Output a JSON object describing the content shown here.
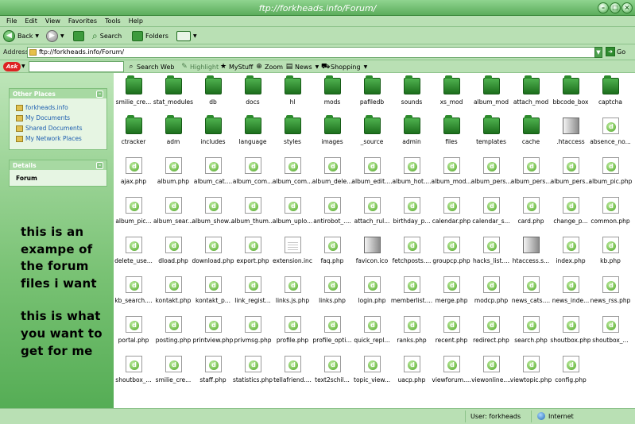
{
  "window": {
    "title": "ftp://forkheads.info/Forum/"
  },
  "menu": [
    "File",
    "Edit",
    "View",
    "Favorites",
    "Tools",
    "Help"
  ],
  "toolbar": {
    "back": "Back",
    "search": "Search",
    "folders": "Folders"
  },
  "address": {
    "label": "Address",
    "value": "ftp://forkheads.info/Forum/",
    "go": "Go"
  },
  "askbar": {
    "logo": "Ask",
    "search_web": "Search Web",
    "highlight": "Highlight",
    "mystuff": "MyStuff",
    "zoom": "Zoom",
    "news": "News",
    "shopping": "Shopping"
  },
  "sidebar": {
    "other_places": {
      "title": "Other Places",
      "items": [
        "forkheads.info",
        "My Documents",
        "Shared Documents",
        "My Network Places"
      ]
    },
    "details": {
      "title": "Details",
      "name": "Forum"
    }
  },
  "annotation": {
    "lines1": [
      "this is an",
      "exampe of",
      "the forum",
      "files i want"
    ],
    "lines2": [
      "this is what",
      "you want to",
      "get for me"
    ]
  },
  "files": [
    {
      "name": "smilie_cre...",
      "type": "folder"
    },
    {
      "name": "stat_modules",
      "type": "folder"
    },
    {
      "name": "db",
      "type": "folder"
    },
    {
      "name": "docs",
      "type": "folder"
    },
    {
      "name": "hl",
      "type": "folder"
    },
    {
      "name": "mods",
      "type": "folder"
    },
    {
      "name": "pafiledb",
      "type": "folder"
    },
    {
      "name": "sounds",
      "type": "folder"
    },
    {
      "name": "xs_mod",
      "type": "folder"
    },
    {
      "name": "album_mod",
      "type": "folder"
    },
    {
      "name": "attach_mod",
      "type": "folder"
    },
    {
      "name": "bbcode_box",
      "type": "folder"
    },
    {
      "name": "captcha",
      "type": "folder"
    },
    {
      "name": "ctracker",
      "type": "folder"
    },
    {
      "name": "adm",
      "type": "folder"
    },
    {
      "name": "includes",
      "type": "folder"
    },
    {
      "name": "language",
      "type": "folder"
    },
    {
      "name": "styles",
      "type": "folder"
    },
    {
      "name": "images",
      "type": "folder"
    },
    {
      "name": "_source",
      "type": "folder"
    },
    {
      "name": "admin",
      "type": "folder"
    },
    {
      "name": "files",
      "type": "folder"
    },
    {
      "name": "templates",
      "type": "folder"
    },
    {
      "name": "cache",
      "type": "folder"
    },
    {
      "name": ".htaccess",
      "type": "gray"
    },
    {
      "name": "absence_no...",
      "type": "php"
    },
    {
      "name": "ajax.php",
      "type": "php"
    },
    {
      "name": "album.php",
      "type": "php"
    },
    {
      "name": "album_cat....",
      "type": "php"
    },
    {
      "name": "album_com...",
      "type": "php"
    },
    {
      "name": "album_com...",
      "type": "php"
    },
    {
      "name": "album_dele...",
      "type": "php"
    },
    {
      "name": "album_edit....",
      "type": "php"
    },
    {
      "name": "album_hot....",
      "type": "php"
    },
    {
      "name": "album_mod...",
      "type": "php"
    },
    {
      "name": "album_pers...",
      "type": "php"
    },
    {
      "name": "album_pers...",
      "type": "php"
    },
    {
      "name": "album_pers...",
      "type": "php"
    },
    {
      "name": "album_pic.php",
      "type": "php"
    },
    {
      "name": "album_pic...",
      "type": "php"
    },
    {
      "name": "album_sear...",
      "type": "php"
    },
    {
      "name": "album_show...",
      "type": "php"
    },
    {
      "name": "album_thum...",
      "type": "php"
    },
    {
      "name": "album_uplo...",
      "type": "php"
    },
    {
      "name": "antirobot_....",
      "type": "php"
    },
    {
      "name": "attach_rul...",
      "type": "php"
    },
    {
      "name": "birthday_p...",
      "type": "php"
    },
    {
      "name": "calendar.php",
      "type": "php"
    },
    {
      "name": "calendar_s...",
      "type": "php"
    },
    {
      "name": "card.php",
      "type": "php"
    },
    {
      "name": "change_p...",
      "type": "php"
    },
    {
      "name": "common.php",
      "type": "php"
    },
    {
      "name": "delete_use...",
      "type": "php"
    },
    {
      "name": "dload.php",
      "type": "php"
    },
    {
      "name": "download.php",
      "type": "php"
    },
    {
      "name": "export.php",
      "type": "php"
    },
    {
      "name": "extension.inc",
      "type": "inc"
    },
    {
      "name": "faq.php",
      "type": "php"
    },
    {
      "name": "favicon.ico",
      "type": "gray"
    },
    {
      "name": "fetchposts....",
      "type": "php"
    },
    {
      "name": "groupcp.php",
      "type": "php"
    },
    {
      "name": "hacks_list....",
      "type": "php"
    },
    {
      "name": "htaccess.s...",
      "type": "gray"
    },
    {
      "name": "index.php",
      "type": "php"
    },
    {
      "name": "kb.php",
      "type": "php"
    },
    {
      "name": "kb_search....",
      "type": "php"
    },
    {
      "name": "kontakt.php",
      "type": "php"
    },
    {
      "name": "kontakt_p...",
      "type": "php"
    },
    {
      "name": "link_regist...",
      "type": "php"
    },
    {
      "name": "links.js.php",
      "type": "php"
    },
    {
      "name": "links.php",
      "type": "php"
    },
    {
      "name": "login.php",
      "type": "php"
    },
    {
      "name": "memberlist....",
      "type": "php"
    },
    {
      "name": "merge.php",
      "type": "php"
    },
    {
      "name": "modcp.php",
      "type": "php"
    },
    {
      "name": "news_cats....",
      "type": "php"
    },
    {
      "name": "news_inde...",
      "type": "php"
    },
    {
      "name": "news_rss.php",
      "type": "php"
    },
    {
      "name": "portal.php",
      "type": "php"
    },
    {
      "name": "posting.php",
      "type": "php"
    },
    {
      "name": "printview.php",
      "type": "php"
    },
    {
      "name": "privmsg.php",
      "type": "php"
    },
    {
      "name": "profile.php",
      "type": "php"
    },
    {
      "name": "profile_opti...",
      "type": "php"
    },
    {
      "name": "quick_repl...",
      "type": "php"
    },
    {
      "name": "ranks.php",
      "type": "php"
    },
    {
      "name": "recent.php",
      "type": "php"
    },
    {
      "name": "redirect.php",
      "type": "php"
    },
    {
      "name": "search.php",
      "type": "php"
    },
    {
      "name": "shoutbox.php",
      "type": "php"
    },
    {
      "name": "shoutbox_...",
      "type": "php"
    },
    {
      "name": "shoutbox_...",
      "type": "php"
    },
    {
      "name": "smilie_cre...",
      "type": "php"
    },
    {
      "name": "staff.php",
      "type": "php"
    },
    {
      "name": "statistics.php",
      "type": "php"
    },
    {
      "name": "tellafriend....",
      "type": "php"
    },
    {
      "name": "text2schil...",
      "type": "php"
    },
    {
      "name": "topic_view...",
      "type": "php"
    },
    {
      "name": "uacp.php",
      "type": "php"
    },
    {
      "name": "viewforum....",
      "type": "php"
    },
    {
      "name": "viewonline....",
      "type": "php"
    },
    {
      "name": "viewtopic.php",
      "type": "php"
    },
    {
      "name": "config.php",
      "type": "php"
    }
  ],
  "status": {
    "user": "User: forkheads",
    "zone": "Internet"
  }
}
